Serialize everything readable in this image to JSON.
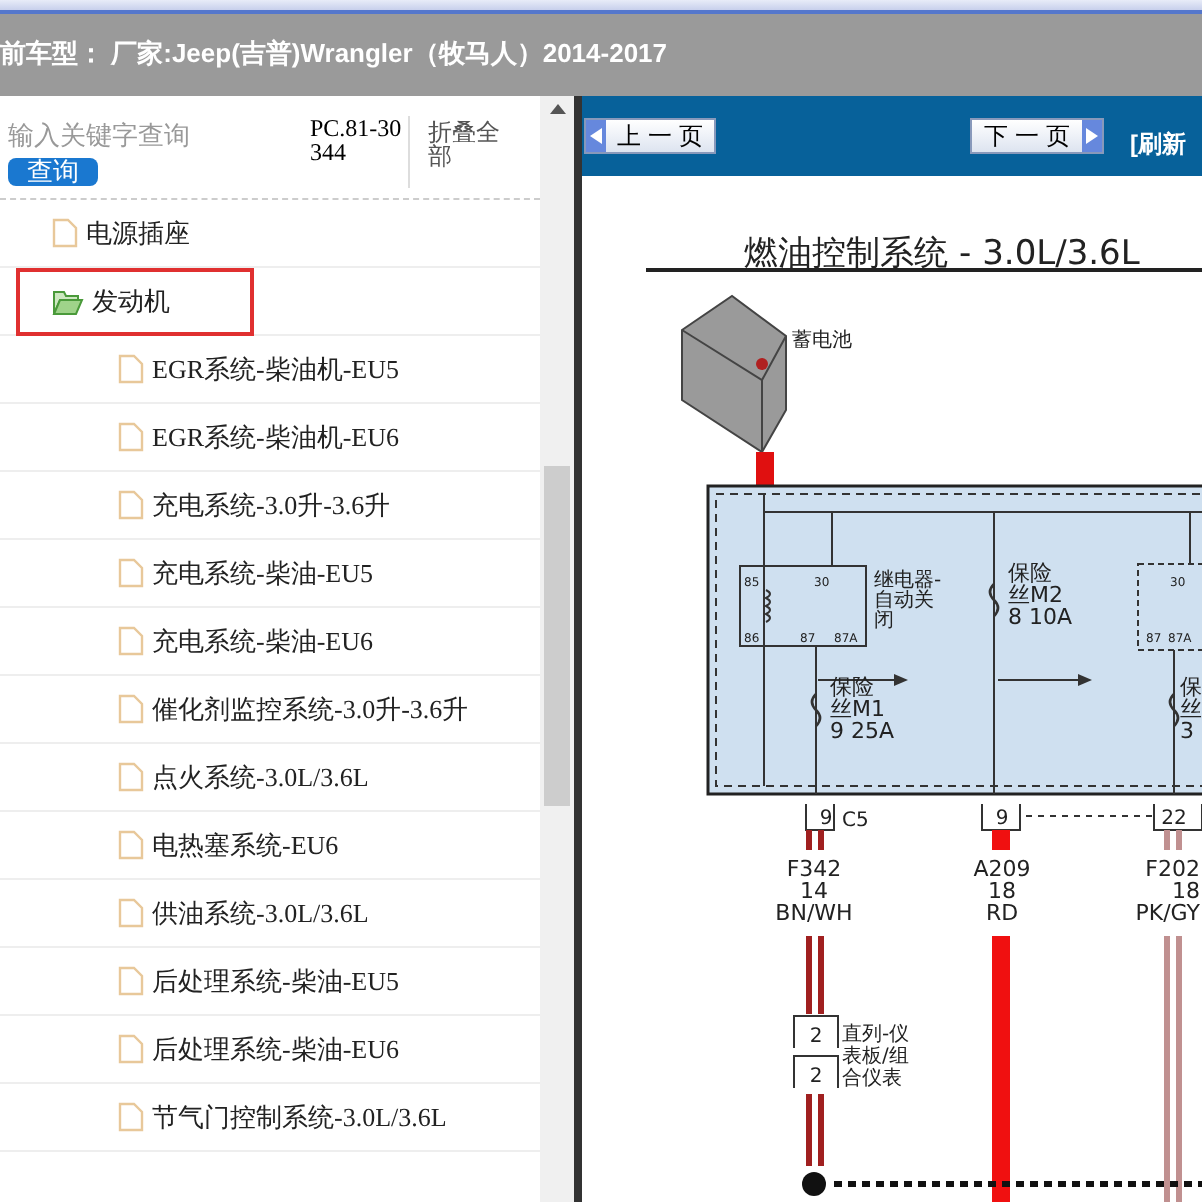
{
  "header": {
    "title": "前车型： 厂家:Jeep(吉普)Wrangler（牧马人）2014-2017"
  },
  "search": {
    "placeholder": "输入关键字查询",
    "button": "查询",
    "code": "PC.81-30344",
    "collapse": "折叠全部"
  },
  "tree": [
    {
      "label": "电源插座",
      "kind": "file",
      "selected": false
    },
    {
      "label": "发动机",
      "kind": "folder",
      "expanded": true,
      "selected": true,
      "children": [
        {
          "label": "EGR系统-柴油机-EU5",
          "kind": "file",
          "selected": false
        },
        {
          "label": "EGR系统-柴油机-EU6",
          "kind": "file",
          "selected": false
        },
        {
          "label": "充电系统-3.0升-3.6升",
          "kind": "file",
          "selected": false
        },
        {
          "label": "充电系统-柴油-EU5",
          "kind": "file",
          "selected": false
        },
        {
          "label": "充电系统-柴油-EU6",
          "kind": "file",
          "selected": false
        },
        {
          "label": "催化剂监控系统-3.0升-3.6升",
          "kind": "file",
          "selected": false
        },
        {
          "label": "点火系统-3.0L/3.6L",
          "kind": "file",
          "selected": false
        },
        {
          "label": "电热塞系统-EU6",
          "kind": "file",
          "selected": false
        },
        {
          "label": "供油系统-3.0L/3.6L",
          "kind": "file",
          "selected": false
        },
        {
          "label": "后处理系统-柴油-EU5",
          "kind": "file",
          "selected": false
        },
        {
          "label": "后处理系统-柴油-EU6",
          "kind": "file",
          "selected": false
        },
        {
          "label": "节气门控制系统-3.0L/3.6L",
          "kind": "file",
          "selected": false
        }
      ]
    }
  ],
  "toolbar": {
    "prev": "上 一 页",
    "next": "下 一 页",
    "refresh": "[刷新"
  },
  "diagram": {
    "title": "燃油控制系统 - 3.0L/3.6L",
    "battery": "蓄电池",
    "relay_pins": [
      "85",
      "30",
      "86",
      "87",
      "87A"
    ],
    "relay_label": [
      "继电器-",
      "自动关",
      "闭"
    ],
    "fuse_m2": [
      "保险",
      "丝M2",
      "8 10A"
    ],
    "fuse_m1": [
      "保险",
      "丝M1",
      "9 25A"
    ],
    "relay2_pins": [
      "30",
      "87",
      "87A"
    ],
    "fuse_3": [
      "保",
      "丝",
      "3"
    ],
    "connectors": [
      {
        "pin": "9",
        "name": "C5"
      },
      {
        "pin": "9"
      },
      {
        "pin": "22"
      }
    ],
    "wires": [
      {
        "circuit": "F342",
        "gauge": "14",
        "code": "BN/WH"
      },
      {
        "circuit": "A209",
        "gauge": "18",
        "code": "RD"
      },
      {
        "circuit": "F202",
        "gauge": "18",
        "code": "PK/GY"
      }
    ],
    "inline": {
      "pins": [
        "2",
        "2"
      ],
      "label": [
        "直列-仪",
        "表板/组",
        "合仪表"
      ]
    }
  }
}
